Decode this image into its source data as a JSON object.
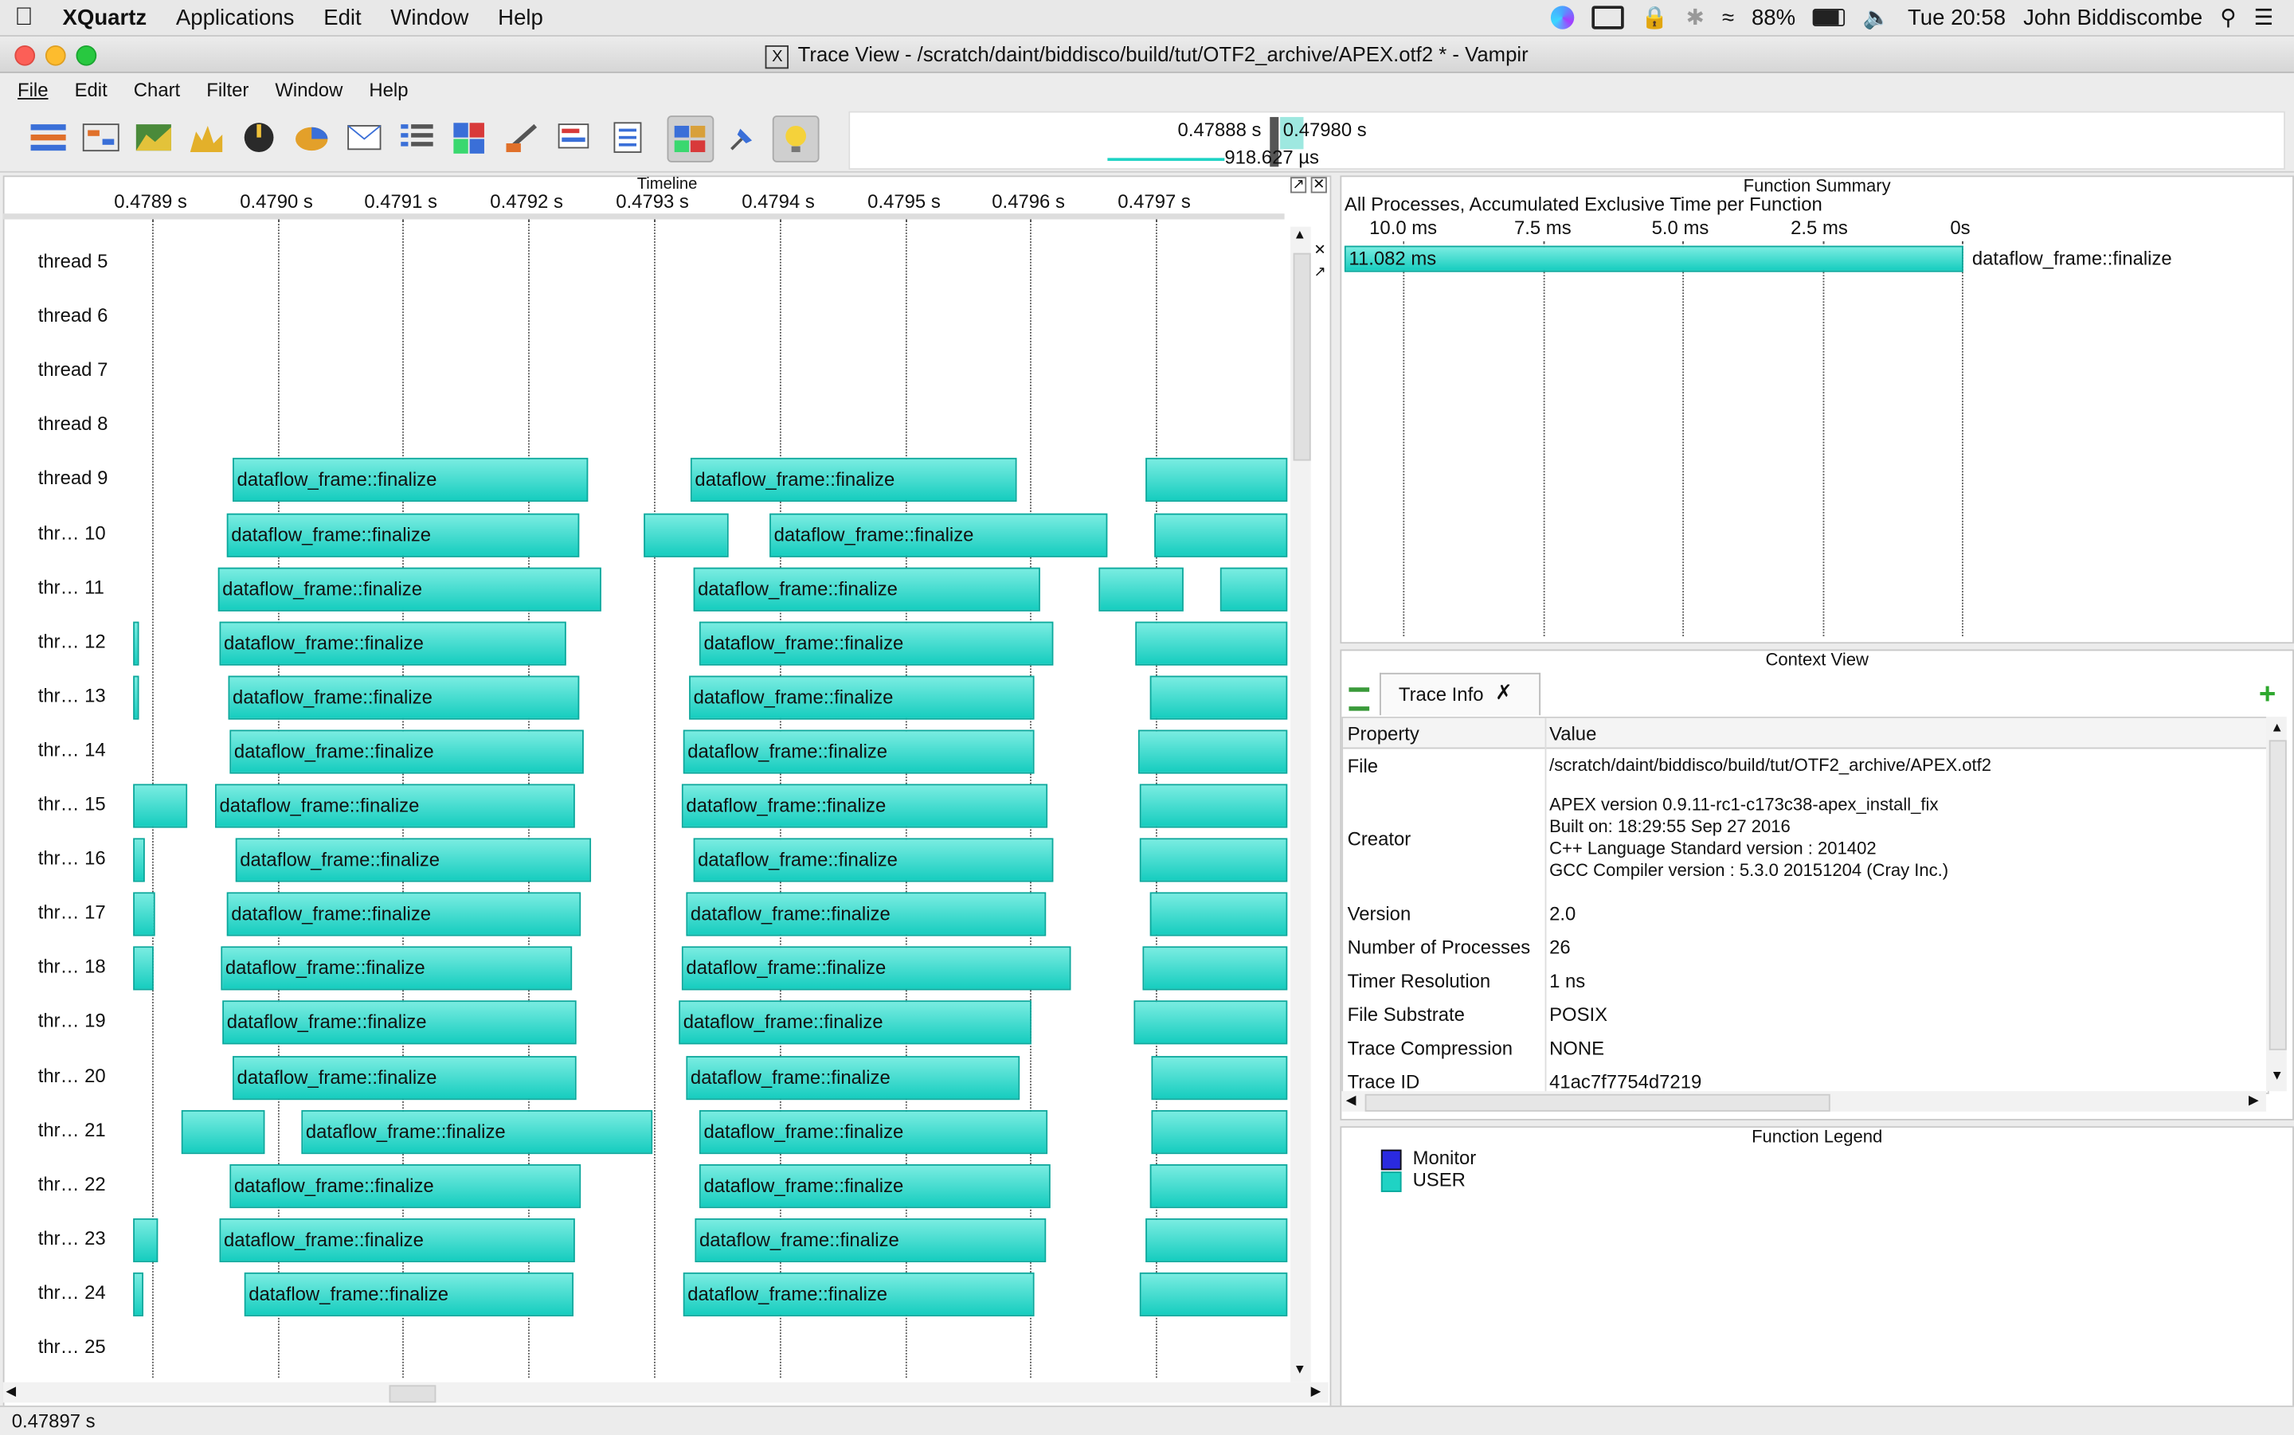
{
  "mac_menubar": {
    "app_name": "XQuartz",
    "items": [
      "Applications",
      "Edit",
      "Window",
      "Help"
    ],
    "battery": "88%",
    "clock": "Tue 20:58",
    "user": "John Biddiscombe"
  },
  "window": {
    "title": "Trace View - /scratch/daint/biddisco/build/tut/OTF2_archive/APEX.otf2 * - Vampir"
  },
  "app_menu": [
    "File",
    "Edit",
    "Chart",
    "Filter",
    "Window",
    "Help"
  ],
  "zoom": {
    "start": "0.47888 s",
    "end": "0.47980 s",
    "duration": "918.627 µs"
  },
  "timeline": {
    "title": "Timeline",
    "ticks": [
      "0.4789 s",
      "0.4790 s",
      "0.4791 s",
      "0.4792 s",
      "0.4793 s",
      "0.4794 s",
      "0.4795 s",
      "0.4796 s",
      "0.4797 s"
    ],
    "rows": [
      "thread 5",
      "thread 6",
      "thread 7",
      "thread 8",
      "thread 9",
      "thr… 10",
      "thr… 11",
      "thr… 12",
      "thr… 13",
      "thr… 14",
      "thr… 15",
      "thr… 16",
      "thr… 17",
      "thr… 18",
      "thr… 19",
      "thr… 20",
      "thr… 21",
      "thr… 22",
      "thr… 23",
      "thr… 24",
      "thr… 25"
    ],
    "bar_label": "dataflow_frame::finalize"
  },
  "function_summary": {
    "title": "Function Summary",
    "subtitle": "All Processes, Accumulated Exclusive Time per Function",
    "axis_ticks": [
      "10.0 ms",
      "7.5 ms",
      "5.0 ms",
      "2.5 ms",
      "0s"
    ],
    "bar_value": "11.082 ms",
    "bar_label": "dataflow_frame::finalize"
  },
  "context_view": {
    "title": "Context View",
    "tab_label": "Trace Info",
    "col_property": "Property",
    "col_value": "Value",
    "file_label": "File",
    "file_value": "/scratch/daint/biddisco/build/tut/OTF2_archive/APEX.otf2",
    "creator_label": "Creator",
    "creator_lines": [
      "APEX version 0.9.11-rc1-c173c38-apex_install_fix",
      "Built on: 18:29:55 Sep 27 2016",
      "C++ Language Standard version : 201402",
      "GCC Compiler version : 5.3.0 20151204 (Cray Inc.)"
    ],
    "rows": [
      {
        "k": "Version",
        "v": "2.0"
      },
      {
        "k": "Number of Processes",
        "v": "26"
      },
      {
        "k": "Timer Resolution",
        "v": "1 ns"
      },
      {
        "k": "File Substrate",
        "v": "POSIX"
      },
      {
        "k": "Trace Compression",
        "v": "NONE"
      },
      {
        "k": "Trace ID",
        "v": "41ac7f7754d7219"
      }
    ]
  },
  "legend": {
    "title": "Function Legend",
    "items": [
      {
        "name": "Monitor",
        "color": "#2a2ae0"
      },
      {
        "name": "USER",
        "color": "#1fd3c4"
      }
    ]
  },
  "status": {
    "time": "0.47897 s"
  },
  "colors": {
    "bar": "#1fd3c4",
    "accent": "#0aa89c"
  }
}
